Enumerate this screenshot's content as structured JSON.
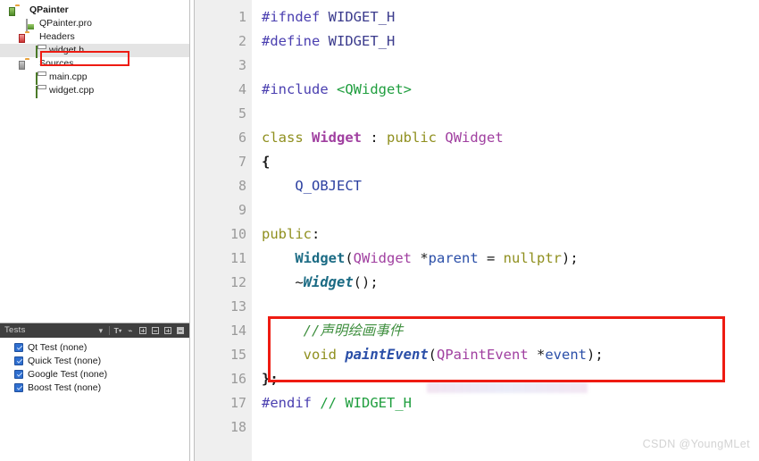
{
  "project_tree": {
    "rows": [
      {
        "label": "QPainter",
        "icon": "folder-icon",
        "arrow": "⌄",
        "indent": 0,
        "bold": true,
        "selected": false
      },
      {
        "label": "QPainter.pro",
        "icon": "project-file-icon",
        "arrow": "",
        "indent": 1,
        "bold": false,
        "selected": false
      },
      {
        "label": "Headers",
        "icon": "folder-headers-icon",
        "arrow": "⌄",
        "indent": 1,
        "bold": false,
        "selected": false
      },
      {
        "label": "widget.h",
        "icon": "source-file-icon",
        "arrow": "",
        "indent": 2,
        "bold": false,
        "selected": true
      },
      {
        "label": "Sources",
        "icon": "folder-sources-icon",
        "arrow": "⌄",
        "indent": 1,
        "bold": false,
        "selected": false
      },
      {
        "label": "main.cpp",
        "icon": "source-file-icon",
        "arrow": "",
        "indent": 2,
        "bold": false,
        "selected": false
      },
      {
        "label": "widget.cpp",
        "icon": "source-file-icon",
        "arrow": "",
        "indent": 2,
        "bold": false,
        "selected": false
      }
    ]
  },
  "tests_panel": {
    "title": "Tests",
    "toolbar": [
      {
        "name": "dropdown-arrow-icon",
        "glyph": "▾"
      },
      {
        "name": "filter-icon",
        "glyph": "T"
      },
      {
        "name": "brush-icon",
        "glyph": "✐"
      },
      {
        "name": "expand-node-icon",
        "glyph": "+"
      },
      {
        "name": "collapse-node-icon",
        "glyph": "−"
      },
      {
        "name": "expand-all-icon",
        "glyph": "+"
      },
      {
        "name": "show-output-icon",
        "glyph": "□"
      }
    ],
    "items": [
      {
        "label": "Qt Test (none)",
        "checked": true
      },
      {
        "label": "Quick Test (none)",
        "checked": true
      },
      {
        "label": "Google Test (none)",
        "checked": true
      },
      {
        "label": "Boost Test (none)",
        "checked": true
      }
    ]
  },
  "editor": {
    "line_numbers": [
      "1",
      "2",
      "3",
      "4",
      "5",
      "6",
      "7",
      "8",
      "9",
      "10",
      "11",
      "12",
      "13",
      "14",
      "15",
      "16",
      "17",
      "18"
    ],
    "fold_marker_line": 6,
    "change_bars": [
      {
        "line": 13,
        "color": "green"
      },
      {
        "line": 14,
        "color": "green"
      },
      {
        "line": 15,
        "color": "green"
      },
      {
        "line": 18,
        "color": "red"
      }
    ],
    "lines": [
      "#ifndef WIDGET_H",
      "#define WIDGET_H",
      "",
      "#include <QWidget>",
      "",
      "class Widget : public QWidget",
      "{",
      "    Q_OBJECT",
      "",
      "public:",
      "    Widget(QWidget *parent = nullptr);",
      "    ~Widget();",
      "",
      "    //声明绘画事件",
      "    void paintEvent(QPaintEvent *event);",
      "};",
      "#endif // WIDGET_H",
      ""
    ],
    "tokens": {
      "l1_pp": "#ifndef",
      "l1_name": "WIDGET_H",
      "l2_pp": "#define",
      "l2_name": "WIDGET_H",
      "l4_pp": "#include",
      "l4_inc": "<QWidget>",
      "l6_kw1": "class",
      "l6_type": "Widget",
      "l6_colon": " : ",
      "l6_kw2": "public",
      "l6_base": "QWidget",
      "l7_brace": "{",
      "l8_macro": "Q_OBJECT",
      "l10_kw": "public",
      "l10_colon": ":",
      "l11_fn": "Widget",
      "l11_p1": "(",
      "l11_cls": "QWidget",
      "l11_star": " *",
      "l11_var": "parent",
      "l11_eq": " = ",
      "l11_null": "nullptr",
      "l11_p2": ");",
      "l12_tilde": "~",
      "l12_fn": "Widget",
      "l12_tail": "();",
      "l14_cmt": "//声明绘画事件",
      "l15_kw": "void",
      "l15_fn": "paintEvent",
      "l15_p1": "(",
      "l15_cls": "QPaintEvent",
      "l15_star": " *",
      "l15_var": "event",
      "l15_p2": ");",
      "l16_end": "};",
      "l17_pp": "#endif",
      "l17_cmt": " // WIDGET_H"
    },
    "annotation_color": "#ee1b12"
  },
  "watermark": {
    "text": "CSDN @YoungMLet"
  }
}
